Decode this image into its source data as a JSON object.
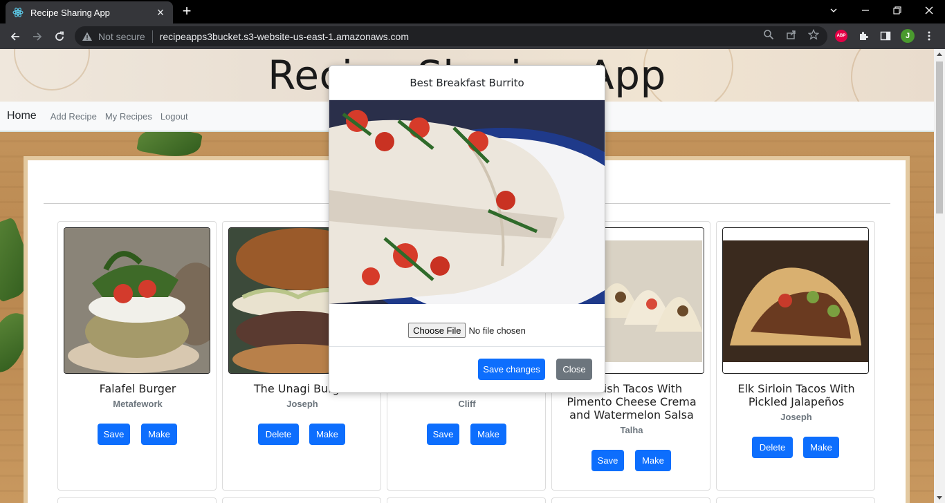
{
  "browser": {
    "tab_title": "Recipe Sharing App",
    "security_label": "Not secure",
    "url": "recipeapps3bucket.s3-website-us-east-1.amazonaws.com",
    "profile_initial": "J",
    "abp_label": "ABP"
  },
  "header": {
    "site_title": "Recipe Sharing App"
  },
  "nav": {
    "brand": "Home",
    "links": [
      "Add Recipe",
      "My Recipes",
      "Logout"
    ]
  },
  "recipes": [
    {
      "title": "Falafel Burger",
      "author": "Metafework",
      "buttons": [
        "Save",
        "Make"
      ]
    },
    {
      "title": "The Unagi Burger",
      "author": "Joseph",
      "buttons": [
        "Delete",
        "Make"
      ]
    },
    {
      "title": "Best Breakfast Burrito",
      "author": "Cliff",
      "buttons": [
        "Save",
        "Make"
      ]
    },
    {
      "title": "Catfish Tacos With Pimento Cheese Crema and Watermelon Salsa",
      "author": "Talha",
      "buttons": [
        "Save",
        "Make"
      ]
    },
    {
      "title": "Elk Sirloin Tacos With Pickled Jalapeños",
      "author": "Joseph",
      "buttons": [
        "Delete",
        "Make"
      ]
    }
  ],
  "modal": {
    "title": "Best Breakfast Burrito",
    "file_button": "Choose File",
    "file_status": "No file chosen",
    "save_label": "Save changes",
    "close_label": "Close"
  },
  "colors": {
    "primary": "#0d6efd",
    "secondary": "#6c757d"
  }
}
